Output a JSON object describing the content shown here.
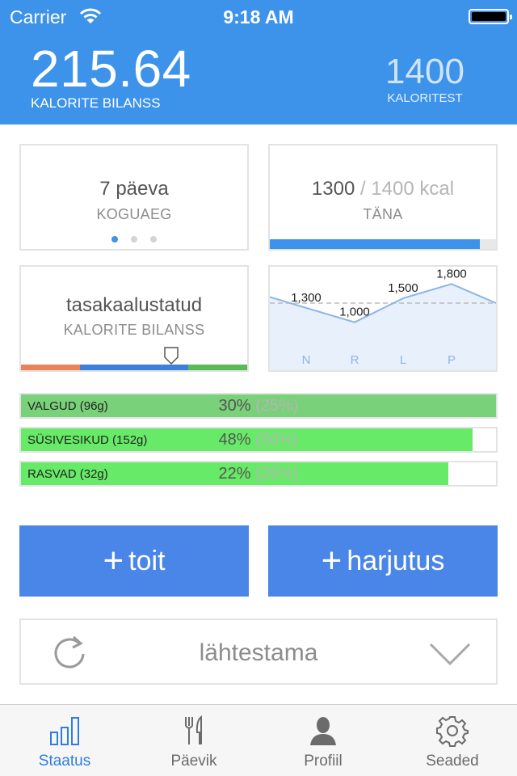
{
  "status_bar": {
    "carrier": "Carrier",
    "time": "9:18 AM"
  },
  "header": {
    "balance_value": "215.64",
    "balance_label": "KALORITE BILANSS",
    "limit_value": "1400",
    "limit_label": "KALORITEST"
  },
  "cards": {
    "duration": {
      "value": "7 päeva",
      "label": "KOGUAEG",
      "page_count": 3,
      "active_page": 1
    },
    "today": {
      "consumed": "1300",
      "separator": "/",
      "goal": "1400 kcal",
      "label": "TÄNA",
      "progress": 0.93
    },
    "balance": {
      "status": "tasakaalustatud",
      "label": "KALORITE BILANSS",
      "segment_colors": [
        "#e8845b",
        "#3d7fd9",
        "#5aba5a"
      ]
    },
    "trend": {
      "chart_data": {
        "type": "line",
        "x": [
          "N",
          "R",
          "L",
          "P"
        ],
        "series": [
          {
            "values": [
              1300,
              1000,
              1500,
              1800
            ]
          }
        ],
        "data_labels": [
          "1,300",
          "1,000",
          "1,500",
          "1,800"
        ],
        "reference_line": 1400,
        "color": "#8db4e8",
        "fill": "#e8f0fb"
      }
    }
  },
  "macros": [
    {
      "name": "VALGUD (96g)",
      "percent": "30%",
      "target": "(25%)",
      "fill": 1.0,
      "color": "#79d179"
    },
    {
      "name": "SÜSIVESIKUD (152g)",
      "percent": "48%",
      "target": "(50%)",
      "fill": 0.95,
      "color": "#67ea67"
    },
    {
      "name": "RASVAD (32g)",
      "percent": "22%",
      "target": "(25%)",
      "fill": 0.9,
      "color": "#67ea67"
    }
  ],
  "actions": {
    "add_food": "toit",
    "add_exercise": "harjutus",
    "plus_symbol": "+"
  },
  "reset": {
    "label": "lähtestama"
  },
  "tabs": [
    {
      "label": "Staatus",
      "icon": "bar-chart-icon",
      "active": true
    },
    {
      "label": "Päevik",
      "icon": "fork-knife-icon",
      "active": false
    },
    {
      "label": "Profiil",
      "icon": "person-icon",
      "active": false
    },
    {
      "label": "Seaded",
      "icon": "gear-icon",
      "active": false
    }
  ],
  "colors": {
    "accent": "#3d92ea",
    "button": "#4a86e8",
    "active_tab": "#2f7de1"
  }
}
